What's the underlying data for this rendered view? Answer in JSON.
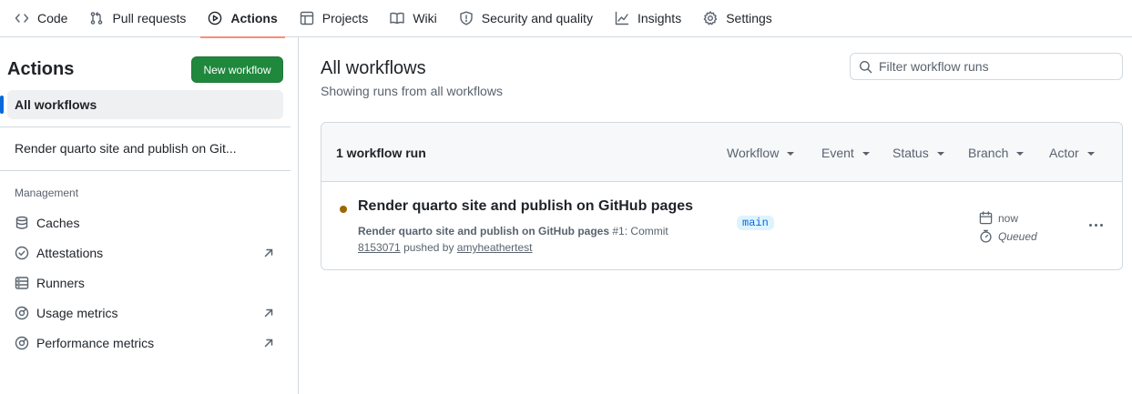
{
  "nav": {
    "tabs": [
      {
        "label": "Code",
        "icon": "code-icon"
      },
      {
        "label": "Pull requests",
        "icon": "pull-request-icon"
      },
      {
        "label": "Actions",
        "icon": "play-icon",
        "active": true
      },
      {
        "label": "Projects",
        "icon": "table-icon"
      },
      {
        "label": "Wiki",
        "icon": "book-icon"
      },
      {
        "label": "Security and quality",
        "icon": "shield-icon"
      },
      {
        "label": "Insights",
        "icon": "graph-icon"
      },
      {
        "label": "Settings",
        "icon": "gear-icon"
      }
    ],
    "active_accent": "#fd8c73"
  },
  "sidebar": {
    "title": "Actions",
    "new_workflow_label": "New workflow",
    "all_workflows_label": "All workflows",
    "workflow_label": "Render quarto site and publish on Git...",
    "management_heading": "Management",
    "management_items": [
      {
        "label": "Caches",
        "icon": "database-icon",
        "external": false
      },
      {
        "label": "Attestations",
        "icon": "verified-icon",
        "external": true
      },
      {
        "label": "Runners",
        "icon": "server-icon",
        "external": false
      },
      {
        "label": "Usage metrics",
        "icon": "meter-icon",
        "external": true
      },
      {
        "label": "Performance metrics",
        "icon": "meter-icon",
        "external": true
      }
    ]
  },
  "main": {
    "title": "All workflows",
    "subtitle": "Showing runs from all workflows",
    "filter_placeholder": "Filter workflow runs",
    "run_count": "1 workflow run",
    "filters": [
      "Workflow",
      "Event",
      "Status",
      "Branch",
      "Actor"
    ],
    "run": {
      "title": "Render quarto site and publish on GitHub pages",
      "workflow_name": "Render quarto site and publish on GitHub pages",
      "run_number": "#1",
      "commit_prefix": ": Commit",
      "commit_sha": "8153071",
      "pushed_by_text": "pushed by",
      "actor": "amyheathertest",
      "branch": "main",
      "time": "now",
      "status": "Queued",
      "status_color": "#9a6700"
    }
  },
  "colors": {
    "primary_button": "#1f883d",
    "link_blue": "#0969da",
    "border": "#d1d9e0",
    "muted_text": "#59636e"
  }
}
